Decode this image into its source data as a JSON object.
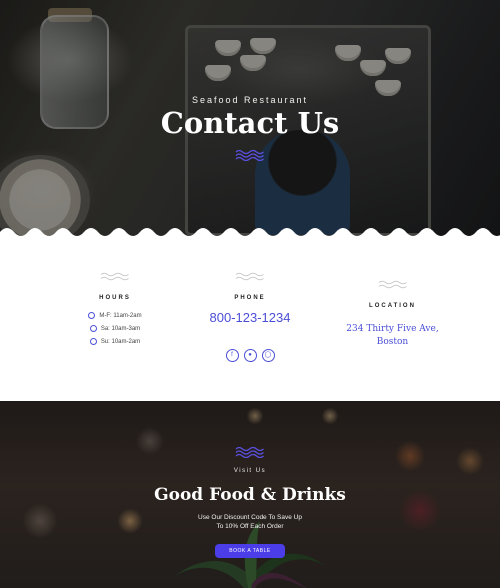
{
  "hero": {
    "subtitle": "Seafood Restaurant",
    "title": "Contact Us"
  },
  "hours": {
    "heading": "HOURS",
    "items": [
      "M-F: 11am-2am",
      "Sa: 10am-3am",
      "Su: 10am-2am"
    ]
  },
  "phone": {
    "heading": "PHONE",
    "number": "800-123-1234",
    "social_icons": [
      "facebook-icon",
      "twitter-icon",
      "instagram-icon"
    ]
  },
  "location": {
    "heading": "LOCATION",
    "address_line1": "234 Thirty Five Ave,",
    "address_line2": "Boston"
  },
  "visit": {
    "subtitle": "Visit Us",
    "title": "Good Food & Drinks",
    "text_line1": "Use Our Discount Code To Save Up",
    "text_line2": "To 10% Off Each Order",
    "button_label": "BOOK A TABLE"
  },
  "colors": {
    "accent": "#4b4ed6",
    "button": "#4b3ee8",
    "text_dark": "#222222"
  }
}
